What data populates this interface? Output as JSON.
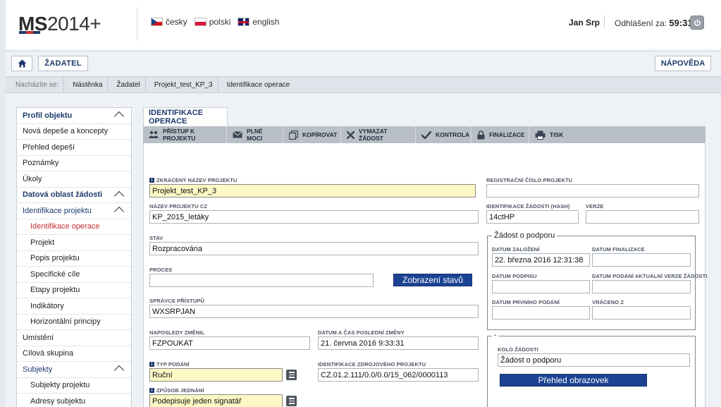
{
  "header": {
    "logo_bold": "MS",
    "logo_rest": "2014+",
    "languages": [
      {
        "label": "česky",
        "flag": "cz-flag-icon"
      },
      {
        "label": "polski",
        "flag": "pl-flag-icon"
      },
      {
        "label": "english",
        "flag": "uk-flag-icon"
      }
    ],
    "user_name": "Jan Srp",
    "logout_label": "Odhlášení za:",
    "logout_timer": "59:31"
  },
  "toolbar": {
    "zadatel_label": "ŽADATEL",
    "help_label": "NÁPOVĚDA"
  },
  "breadcrumb": {
    "lead": "Nacházíte se:",
    "items": [
      "Nástěnka",
      "Žadatel",
      "Projekt_test_KP_3"
    ],
    "current": "Identifikace operace"
  },
  "sidebar": {
    "items": [
      {
        "label": "Profil objektu"
      },
      {
        "label": "Nová depeše a koncepty"
      },
      {
        "label": "Přehled depeší"
      },
      {
        "label": "Poznámky"
      },
      {
        "label": "Úkoly"
      },
      {
        "label": "Datová oblast žádosti"
      },
      {
        "label": "Identifikace projektu"
      },
      {
        "label": "Identifikace operace"
      },
      {
        "label": "Projekt"
      },
      {
        "label": "Popis projektu"
      },
      {
        "label": "Specifické cíle"
      },
      {
        "label": "Etapy projektu"
      },
      {
        "label": "Indikátory"
      },
      {
        "label": "Horizontální principy"
      },
      {
        "label": "Umístění"
      },
      {
        "label": "Cílová skupina"
      },
      {
        "label": "Subjekty"
      },
      {
        "label": "Subjekty projektu"
      },
      {
        "label": "Adresy subjektu"
      }
    ]
  },
  "main": {
    "tab_title": "IDENTIFIKACE OPERACE",
    "actions": [
      {
        "label": "PŘÍSTUP K PROJEKTU",
        "icon": "users-icon"
      },
      {
        "label": "PLNÉ MOCI",
        "icon": "envelope-icon"
      },
      {
        "label": "KOPÍROVAT",
        "icon": "copy-icon"
      },
      {
        "label": "VYMAZAT ŽÁDOST",
        "icon": "delete-x-icon"
      },
      {
        "label": "KONTROLA",
        "icon": "checkmark-icon"
      },
      {
        "label": "FINALIZACE",
        "icon": "lock-icon"
      },
      {
        "label": "TISK",
        "icon": "printer-icon"
      }
    ],
    "fields": {
      "short_name": {
        "label": "ZKRÁCENÝ NÁZEV PROJEKTU",
        "value": "Projekt_test_KP_3"
      },
      "name_cz": {
        "label": "NÁZEV PROJEKTU CZ",
        "value": "KP_2015_letáky"
      },
      "state": {
        "label": "STAV",
        "value": "Rozpracována"
      },
      "process": {
        "label": "PROCES",
        "value": ""
      },
      "show_states_button": "Zobrazení stavů",
      "access_admin": {
        "label": "SPRÁVCE PŘÍSTUPŮ",
        "value": "WXSRPJAN"
      },
      "last_changed": {
        "label": "NAPOSLEDY ZMĚNIL",
        "value": "FZPOUKAT"
      },
      "last_change_time": {
        "label": "DATUM A ČAS POSLEDNÍ ZMĚNY",
        "value": "21. června 2016 9:33:31"
      },
      "submission_type": {
        "label": "TYP PODÁNÍ",
        "value": "Ruční"
      },
      "source_project_id": {
        "label": "IDENTIFIKACE ZDROJOVÉHO PROJEKTU",
        "value": "CZ.01.2.111/0.0/0.0/15_062/0000113"
      },
      "negotiation_method": {
        "label": "ZPŮSOB JEDNÁNÍ",
        "value": "Podepisuje jeden signatář"
      },
      "reg_number": {
        "label": "REGISTRAČNÍ ČÍSLO PROJEKTU",
        "value": ""
      },
      "hash_id": {
        "label": "IDENTIFIKACE ŽÁDOSTI (HASH)",
        "value": "14ctHP"
      },
      "version": {
        "label": "VERZE",
        "value": ""
      }
    },
    "support_group": {
      "legend": "Žádost o podporu",
      "created": {
        "label": "DATUM ZALOŽENÍ",
        "value": "22. března 2016 12:31:38"
      },
      "finalized": {
        "label": "DATUM FINALIZACE",
        "value": ""
      },
      "signed": {
        "label": "DATUM PODPISU",
        "value": ""
      },
      "current_submitted": {
        "label": "DATUM PODÁNÍ AKTUÁLNÍ VERZE ŽÁDOSTI",
        "value": ""
      },
      "first_submitted": {
        "label": "DATUM PRVNÍHO PODÁNÍ",
        "value": ""
      },
      "returned": {
        "label": "VRÁCENO Z",
        "value": ""
      }
    },
    "round_group": {
      "legend": "-",
      "round": {
        "label": "KOLO ŽÁDOSTI",
        "value": "Žádost o podporu"
      },
      "overview_button": "Přehled obrazovek"
    }
  },
  "colors": {
    "brand_navy": "#1d3a6b",
    "button_blue": "#1c4393",
    "required_yellow": "#fdf8c4",
    "active_red": "#c73131"
  }
}
